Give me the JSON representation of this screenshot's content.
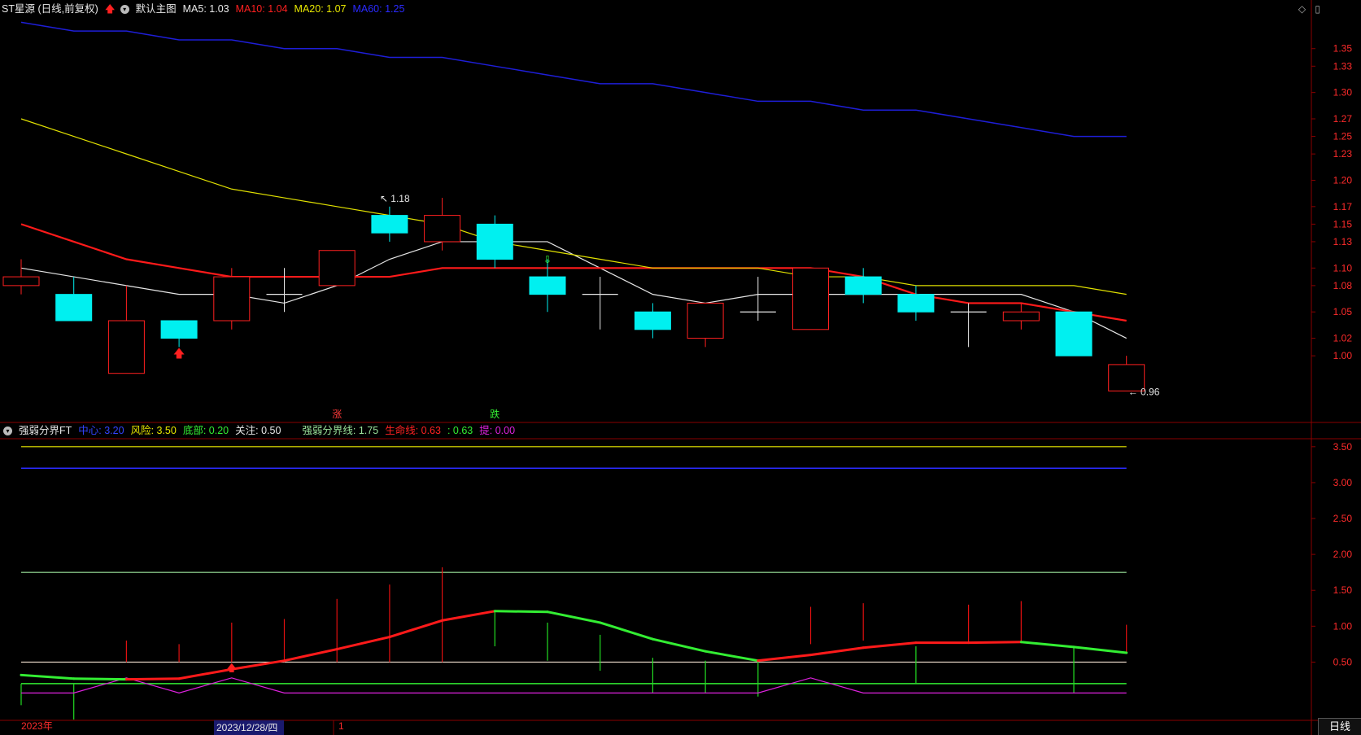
{
  "header_main": {
    "stock": "ST星源 (日线,前复权)",
    "view": "默认主图",
    "ma5": "MA5: 1.03",
    "ma10": "MA10: 1.04",
    "ma20": "MA20: 1.07",
    "ma60": "MA60: 1.25"
  },
  "header_sub": {
    "name": "强弱分界FT",
    "items": [
      {
        "text": "中心: 3.20",
        "color": "#3344ff"
      },
      {
        "text": "风险: 3.50",
        "color": "#e8e800"
      },
      {
        "text": "底部: 0.20",
        "color": "#33ee33"
      },
      {
        "text": "关注: 0.50",
        "color": "#e8e8e8"
      },
      {
        "text": "强弱分界线: 1.75",
        "color": "#9be39b"
      },
      {
        "text": "生命线: 0.63",
        "color": "#ff2222"
      },
      {
        "text": ": 0.63",
        "color": "#33ee33"
      },
      {
        "text": "提: 0.00",
        "color": "#dd22dd"
      }
    ]
  },
  "bottom_tab": "日线",
  "colors": {
    "up": "#ff2020",
    "down": "#00f0f0",
    "ma5": "#e6e6e6",
    "ma10": "#ff1a1a",
    "ma20": "#e0e000",
    "ma60": "#1e1ed8",
    "border": "#8a0000",
    "axis_text": "#ff2b2b"
  },
  "chart_data": [
    {
      "type": "candlestick",
      "title": "ST星源 (日线,前复权)",
      "ylim": [
        0.925,
        1.385
      ],
      "yticks": [
        1.0,
        1.02,
        1.05,
        1.08,
        1.1,
        1.13,
        1.15,
        1.17,
        1.2,
        1.23,
        1.25,
        1.27,
        1.3,
        1.33,
        1.35
      ],
      "candles": [
        {
          "o": 1.08,
          "h": 1.11,
          "l": 1.07,
          "c": 1.09
        },
        {
          "o": 1.07,
          "h": 1.09,
          "l": 1.04,
          "c": 1.04
        },
        {
          "o": 0.98,
          "h": 1.08,
          "l": 0.98,
          "c": 1.04
        },
        {
          "o": 1.04,
          "h": 1.04,
          "l": 1.01,
          "c": 1.02
        },
        {
          "o": 1.04,
          "h": 1.1,
          "l": 1.03,
          "c": 1.09
        },
        {
          "o": 1.07,
          "h": 1.1,
          "l": 1.05,
          "c": 1.07
        },
        {
          "o": 1.08,
          "h": 1.12,
          "l": 1.08,
          "c": 1.12
        },
        {
          "o": 1.16,
          "h": 1.17,
          "l": 1.13,
          "c": 1.14
        },
        {
          "o": 1.13,
          "h": 1.18,
          "l": 1.12,
          "c": 1.16
        },
        {
          "o": 1.15,
          "h": 1.16,
          "l": 1.1,
          "c": 1.11
        },
        {
          "o": 1.09,
          "h": 1.11,
          "l": 1.05,
          "c": 1.07
        },
        {
          "o": 1.07,
          "h": 1.09,
          "l": 1.03,
          "c": 1.07
        },
        {
          "o": 1.05,
          "h": 1.06,
          "l": 1.02,
          "c": 1.03
        },
        {
          "o": 1.02,
          "h": 1.06,
          "l": 1.01,
          "c": 1.06
        },
        {
          "o": 1.05,
          "h": 1.09,
          "l": 1.04,
          "c": 1.05
        },
        {
          "o": 1.03,
          "h": 1.1,
          "l": 1.03,
          "c": 1.1
        },
        {
          "o": 1.09,
          "h": 1.1,
          "l": 1.06,
          "c": 1.07
        },
        {
          "o": 1.07,
          "h": 1.08,
          "l": 1.04,
          "c": 1.05
        },
        {
          "o": 1.05,
          "h": 1.06,
          "l": 1.01,
          "c": 1.05
        },
        {
          "o": 1.04,
          "h": 1.06,
          "l": 1.03,
          "c": 1.05
        },
        {
          "o": 1.05,
          "h": 1.05,
          "l": 1.0,
          "c": 1.0
        },
        {
          "o": 0.96,
          "h": 1.0,
          "l": 0.96,
          "c": 0.99
        }
      ],
      "series": [
        {
          "name": "MA5",
          "values": [
            1.1,
            1.09,
            1.08,
            1.07,
            1.07,
            1.06,
            1.08,
            1.11,
            1.13,
            1.13,
            1.13,
            1.1,
            1.07,
            1.06,
            1.07,
            1.07,
            1.07,
            1.07,
            1.07,
            1.07,
            1.05,
            1.02
          ]
        },
        {
          "name": "MA10",
          "values": [
            1.15,
            1.13,
            1.11,
            1.1,
            1.09,
            1.09,
            1.09,
            1.09,
            1.1,
            1.1,
            1.1,
            1.1,
            1.1,
            1.1,
            1.1,
            1.1,
            1.09,
            1.07,
            1.06,
            1.06,
            1.05,
            1.04
          ]
        },
        {
          "name": "MA20",
          "values": [
            1.27,
            1.25,
            1.23,
            1.21,
            1.19,
            1.18,
            1.17,
            1.16,
            1.15,
            1.13,
            1.12,
            1.11,
            1.1,
            1.1,
            1.1,
            1.09,
            1.09,
            1.08,
            1.08,
            1.08,
            1.08,
            1.07
          ]
        },
        {
          "name": "MA60",
          "values": [
            1.38,
            1.37,
            1.37,
            1.36,
            1.36,
            1.35,
            1.35,
            1.34,
            1.34,
            1.33,
            1.32,
            1.31,
            1.31,
            1.3,
            1.29,
            1.29,
            1.28,
            1.28,
            1.27,
            1.26,
            1.25,
            1.25
          ]
        }
      ],
      "annotations": [
        {
          "text": "1.18",
          "index": 7,
          "value": 1.18
        },
        {
          "text": "0.96",
          "index": 21,
          "value": 0.96
        },
        {
          "text": "涨",
          "index": 6
        },
        {
          "text": "跌",
          "index": 9
        }
      ]
    },
    {
      "type": "line",
      "title": "强弱分界FT",
      "ylim": [
        -0.3,
        3.6
      ],
      "yticks": [
        0.5,
        1.0,
        1.5,
        2.0,
        2.5,
        3.0,
        3.5
      ],
      "x_labels": [
        "2023年",
        "2023/12/28/四",
        "1"
      ],
      "hlines": [
        {
          "name": "风险",
          "value": 3.5
        },
        {
          "name": "中心",
          "value": 3.2
        },
        {
          "name": "强弱分界线",
          "value": 1.75
        },
        {
          "name": "关注",
          "value": 0.5
        },
        {
          "name": "底部",
          "value": 0.2
        }
      ],
      "series": [
        {
          "name": "生命线",
          "values": [
            0.32,
            0.27,
            0.26,
            0.27,
            0.4,
            0.52,
            0.68,
            0.85,
            1.08,
            1.21,
            1.2,
            1.05,
            0.82,
            0.65,
            0.52,
            0.6,
            0.7,
            0.77,
            0.77,
            0.78,
            0.71,
            0.63
          ],
          "trend": [
            "g",
            "g",
            "g",
            "r",
            "r",
            "r",
            "r",
            "r",
            "r",
            "r",
            "g",
            "g",
            "g",
            "g",
            "g",
            "r",
            "r",
            "r",
            "r",
            "r",
            "g",
            "g"
          ]
        },
        {
          "name": "提",
          "values": [
            0.07,
            0.07,
            0.28,
            0.07,
            0.28,
            0.07,
            0.07,
            0.07,
            0.07,
            0.07,
            0.07,
            0.07,
            0.07,
            0.07,
            0.07,
            0.28,
            0.07,
            0.07,
            0.07,
            0.07,
            0.07,
            0.07
          ]
        }
      ],
      "sticks": [
        {
          "type": "g",
          "from": 0.2,
          "to": -0.1
        },
        {
          "type": "g",
          "from": 0.2,
          "to": -0.3
        },
        {
          "type": "r",
          "from": 0.5,
          "to": 0.8
        },
        {
          "type": "r",
          "from": 0.5,
          "to": 0.75
        },
        {
          "type": "r",
          "from": 0.5,
          "to": 1.05
        },
        {
          "type": "r",
          "from": 0.5,
          "to": 1.1
        },
        {
          "type": "r",
          "from": 0.5,
          "to": 1.38
        },
        {
          "type": "r",
          "from": 0.5,
          "to": 1.58
        },
        {
          "type": "r",
          "from": 0.5,
          "to": 1.82
        },
        {
          "type": "g",
          "from": 1.2,
          "to": 0.72
        },
        {
          "type": "g",
          "from": 1.05,
          "to": 0.52
        },
        {
          "type": "g",
          "from": 0.88,
          "to": 0.38
        },
        {
          "type": "g",
          "from": 0.56,
          "to": 0.07
        },
        {
          "type": "g",
          "from": 0.52,
          "to": 0.07
        },
        {
          "type": "g",
          "from": 0.52,
          "to": 0.02
        },
        {
          "type": "r",
          "from": 0.75,
          "to": 1.27
        },
        {
          "type": "r",
          "from": 0.8,
          "to": 1.32
        },
        {
          "type": "g",
          "from": 0.72,
          "to": 0.2
        },
        {
          "type": "r",
          "from": 0.78,
          "to": 1.3
        },
        {
          "type": "r",
          "from": 0.78,
          "to": 1.35
        },
        {
          "type": "g",
          "from": 0.71,
          "to": 0.07
        },
        {
          "type": "r",
          "from": 0.63,
          "to": 1.02
        }
      ]
    }
  ]
}
